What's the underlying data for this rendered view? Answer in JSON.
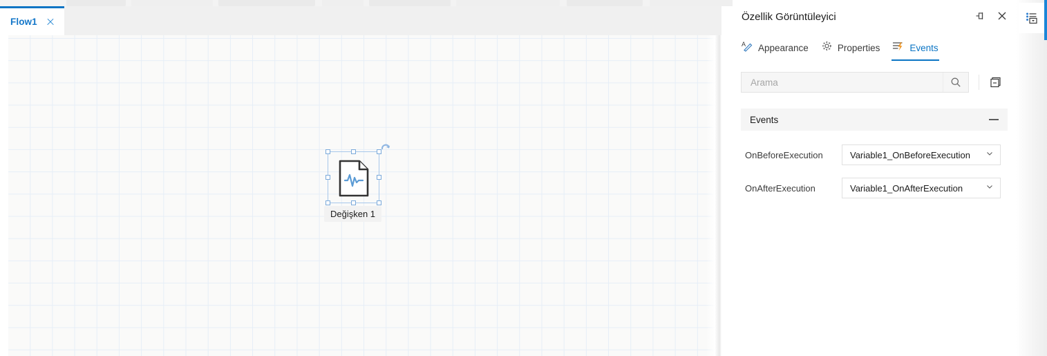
{
  "document_tabs": {
    "items": [
      {
        "label": "Flow1",
        "active": true,
        "close_icon": "close-icon"
      }
    ]
  },
  "canvas": {
    "node": {
      "label": "Değişken 1",
      "icon": "document-waveform-icon",
      "selected": true,
      "rotate_handle_icon": "rotate-icon"
    }
  },
  "panel": {
    "title": "Özellik Görüntüleyici",
    "header_actions": [
      {
        "name": "pin-icon",
        "tooltip": "Pin"
      },
      {
        "name": "close-icon",
        "tooltip": "Close"
      }
    ],
    "tabs": [
      {
        "label": "Appearance",
        "icon": "appearance-pencil-icon",
        "active": false
      },
      {
        "label": "Properties",
        "icon": "gear-icon",
        "active": false
      },
      {
        "label": "Events",
        "icon": "events-lightning-icon",
        "active": true
      }
    ],
    "search": {
      "placeholder": "Arama",
      "value": "",
      "search_icon": "search-icon",
      "collapse_all_icon": "collapse-all-icon"
    },
    "groups": [
      {
        "title": "Events",
        "collapsed": false,
        "toggle_icon": "minus-icon",
        "rows": [
          {
            "label": "OnBeforeExecution",
            "value": "Variable1_OnBeforeExecution",
            "chevron_icon": "chevron-down-icon"
          },
          {
            "label": "OnAfterExecution",
            "value": "Variable1_OnAfterExecution",
            "chevron_icon": "chevron-down-icon"
          }
        ]
      }
    ]
  },
  "right_rail": {
    "buttons": [
      {
        "name": "property-viewer-icon",
        "active": true
      }
    ]
  },
  "colors": {
    "accent": "#0a74c4",
    "tab_active_text": "#1477c9",
    "grid_line": "#e6eef7",
    "canvas_bg": "#fafaf9",
    "selection": "#7aa9da",
    "events_icon": "#f0941f"
  }
}
